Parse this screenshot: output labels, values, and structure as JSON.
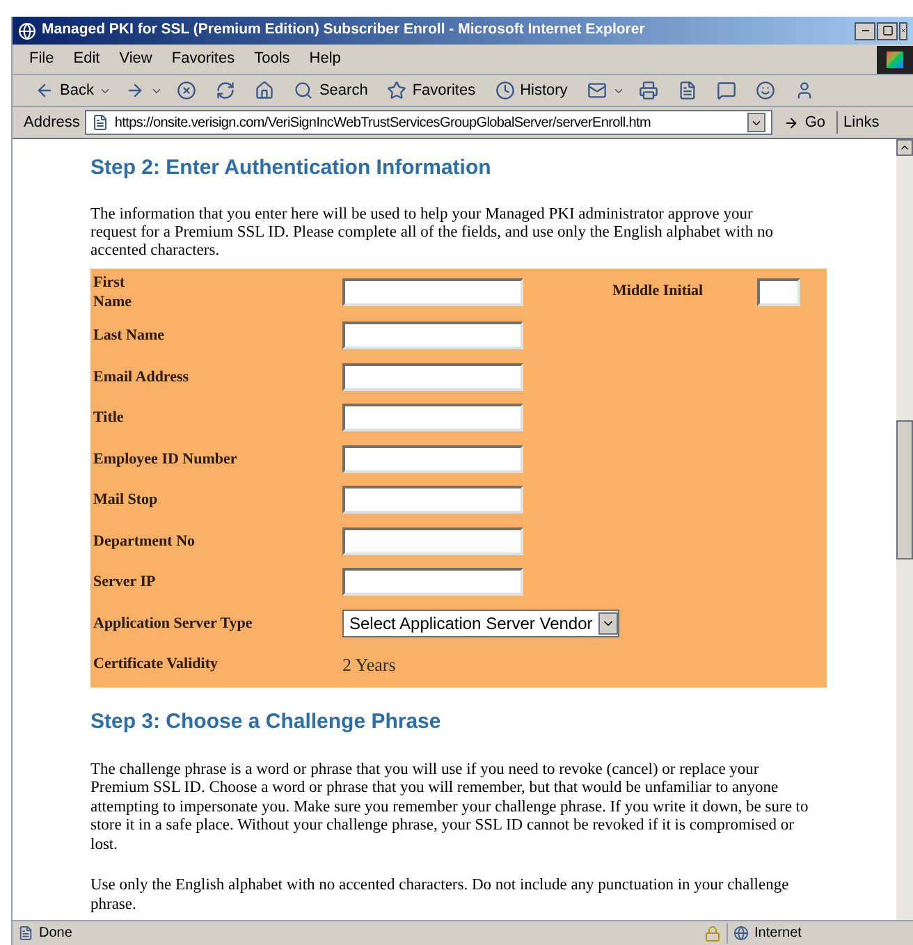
{
  "window": {
    "title": "Managed PKI for SSL (Premium Edition) Subscriber Enroll - Microsoft Internet Explorer"
  },
  "menu_bar": [
    "File",
    "Edit",
    "View",
    "Favorites",
    "Tools",
    "Help"
  ],
  "toolbar": [
    {
      "kind": "back",
      "label": "Back"
    },
    {
      "kind": "forward"
    },
    {
      "kind": "stop"
    },
    {
      "kind": "refresh"
    },
    {
      "kind": "home"
    },
    {
      "kind": "search",
      "label": "Search"
    },
    {
      "kind": "favorites",
      "label": "Favorites"
    },
    {
      "kind": "history",
      "label": "History"
    },
    {
      "kind": "mail"
    },
    {
      "kind": "print"
    },
    {
      "kind": "edit"
    },
    {
      "kind": "discuss"
    },
    {
      "kind": "messenger"
    },
    {
      "kind": "person"
    }
  ],
  "address_bar": {
    "label": "Address",
    "url": "https://onsite.verisign.com/VeriSignIncWebTrustServicesGroupGlobalServer/serverEnroll.htm",
    "go": "Go",
    "links": "Links"
  },
  "step2": {
    "heading": "Step 2: Enter Authentication Information",
    "intro": "The information that you enter here will be used to help your Managed PKI administrator approve your request for a Premium SSL ID. Please complete all of the fields, and use only the English alphabet with no accented characters."
  },
  "form_fields": [
    {
      "kind": "text",
      "label": "First Name",
      "side_label": "Middle Initial"
    },
    {
      "kind": "text",
      "label": "Last Name"
    },
    {
      "kind": "text",
      "label": "Email Address"
    },
    {
      "kind": "text",
      "label": "Title"
    },
    {
      "kind": "text",
      "label": "Employee ID Number"
    },
    {
      "kind": "text",
      "label": "Mail Stop"
    },
    {
      "kind": "text",
      "label": "Department No"
    },
    {
      "kind": "text",
      "label": "Server IP"
    },
    {
      "kind": "select",
      "label": "Application Server Type",
      "value": "Select Application Server Vendor"
    },
    {
      "kind": "static",
      "label": "Certificate Validity",
      "value": "2 Years"
    }
  ],
  "step3": {
    "heading": "Step 3: Choose a Challenge Phrase",
    "paragraphs": [
      "The challenge phrase is a word or phrase that you will use if you need to revoke (cancel) or replace your Premium SSL ID. Choose a word or phrase that you will remember, but that would be unfamiliar to anyone attempting to impersonate you. Make sure you remember your challenge phrase. If you write it down, be sure to store it in a safe place. Without your challenge phrase, your SSL ID cannot be revoked if it is compromised or lost.",
      "Use only the English alphabet with no accented characters. Do not include any punctuation in your challenge phrase."
    ]
  },
  "status_bar": {
    "text": "Done",
    "zone": "Internet"
  }
}
